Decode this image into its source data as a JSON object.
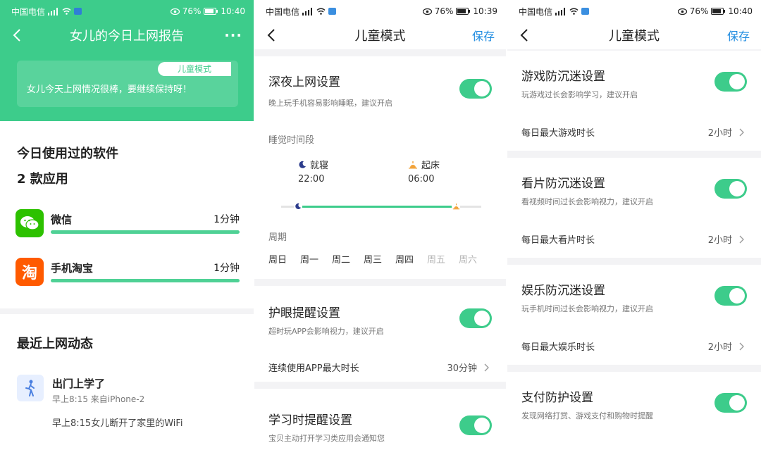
{
  "status_bars": [
    {
      "carrier": "中国电信",
      "battery": "76%",
      "time": "10:40"
    },
    {
      "carrier": "中国电信",
      "battery": "76%",
      "time": "10:39"
    },
    {
      "carrier": "中国电信",
      "battery": "76%",
      "time": "10:40"
    }
  ],
  "report": {
    "title": "女儿的今日上网报告",
    "tag": "儿童模式",
    "message": "女儿今天上网情况很棒，要继续保持呀！",
    "apps_section_title": "今日使用过的软件",
    "app_count": "2 款应用",
    "apps": [
      {
        "name": "微信",
        "time": "1分钟",
        "icon": "wechat-icon",
        "color": "#2dc100"
      },
      {
        "name": "手机淘宝",
        "time": "1分钟",
        "icon": "taobao-icon",
        "color": "#ff5a00"
      }
    ],
    "activity_section_title": "最近上网动态",
    "activity": {
      "title": "出门上学了",
      "meta": "早上8:15 来自iPhone-2",
      "detail": "早上8:15女儿断开了家里的WiFi"
    }
  },
  "kids_mode": {
    "title": "儿童模式",
    "save_label": "保存",
    "night": {
      "title": "深夜上网设置",
      "sub": "晚上玩手机容易影响睡眠，建议开启",
      "enabled": true,
      "sleep_label": "睡觉时间段",
      "bedtime_label": "就寝",
      "bedtime": "22:00",
      "wake_label": "起床",
      "wake": "06:00",
      "cycle_label": "周期",
      "weekdays": [
        {
          "label": "周日",
          "on": true
        },
        {
          "label": "周一",
          "on": true
        },
        {
          "label": "周二",
          "on": true
        },
        {
          "label": "周三",
          "on": true
        },
        {
          "label": "周四",
          "on": true
        },
        {
          "label": "周五",
          "on": false
        },
        {
          "label": "周六",
          "on": false
        }
      ]
    },
    "eye": {
      "title": "护眼提醒设置",
      "sub": "超时玩APP会影响视力，建议开启",
      "enabled": true,
      "row_label": "连续使用APP最大时长",
      "row_value": "30分钟"
    },
    "study": {
      "title": "学习时提醒设置",
      "sub": "宝贝主动打开学习类应用会通知您",
      "enabled": true
    }
  },
  "kids_mode_2": {
    "title": "儿童模式",
    "save_label": "保存",
    "sections": [
      {
        "title": "游戏防沉迷设置",
        "sub": "玩游戏过长会影响学习，建议开启",
        "enabled": true,
        "row_label": "每日最大游戏时长",
        "row_value": "2小时"
      },
      {
        "title": "看片防沉迷设置",
        "sub": "看视频时间过长会影响视力，建议开启",
        "enabled": true,
        "row_label": "每日最大看片时长",
        "row_value": "2小时"
      },
      {
        "title": "娱乐防沉迷设置",
        "sub": "玩手机时间过长会影响视力，建议开启",
        "enabled": true,
        "row_label": "每日最大娱乐时长",
        "row_value": "2小时"
      }
    ],
    "payment": {
      "title": "支付防护设置",
      "sub": "发现网络打赏、游戏支付和购物时提醒",
      "enabled": true
    }
  }
}
